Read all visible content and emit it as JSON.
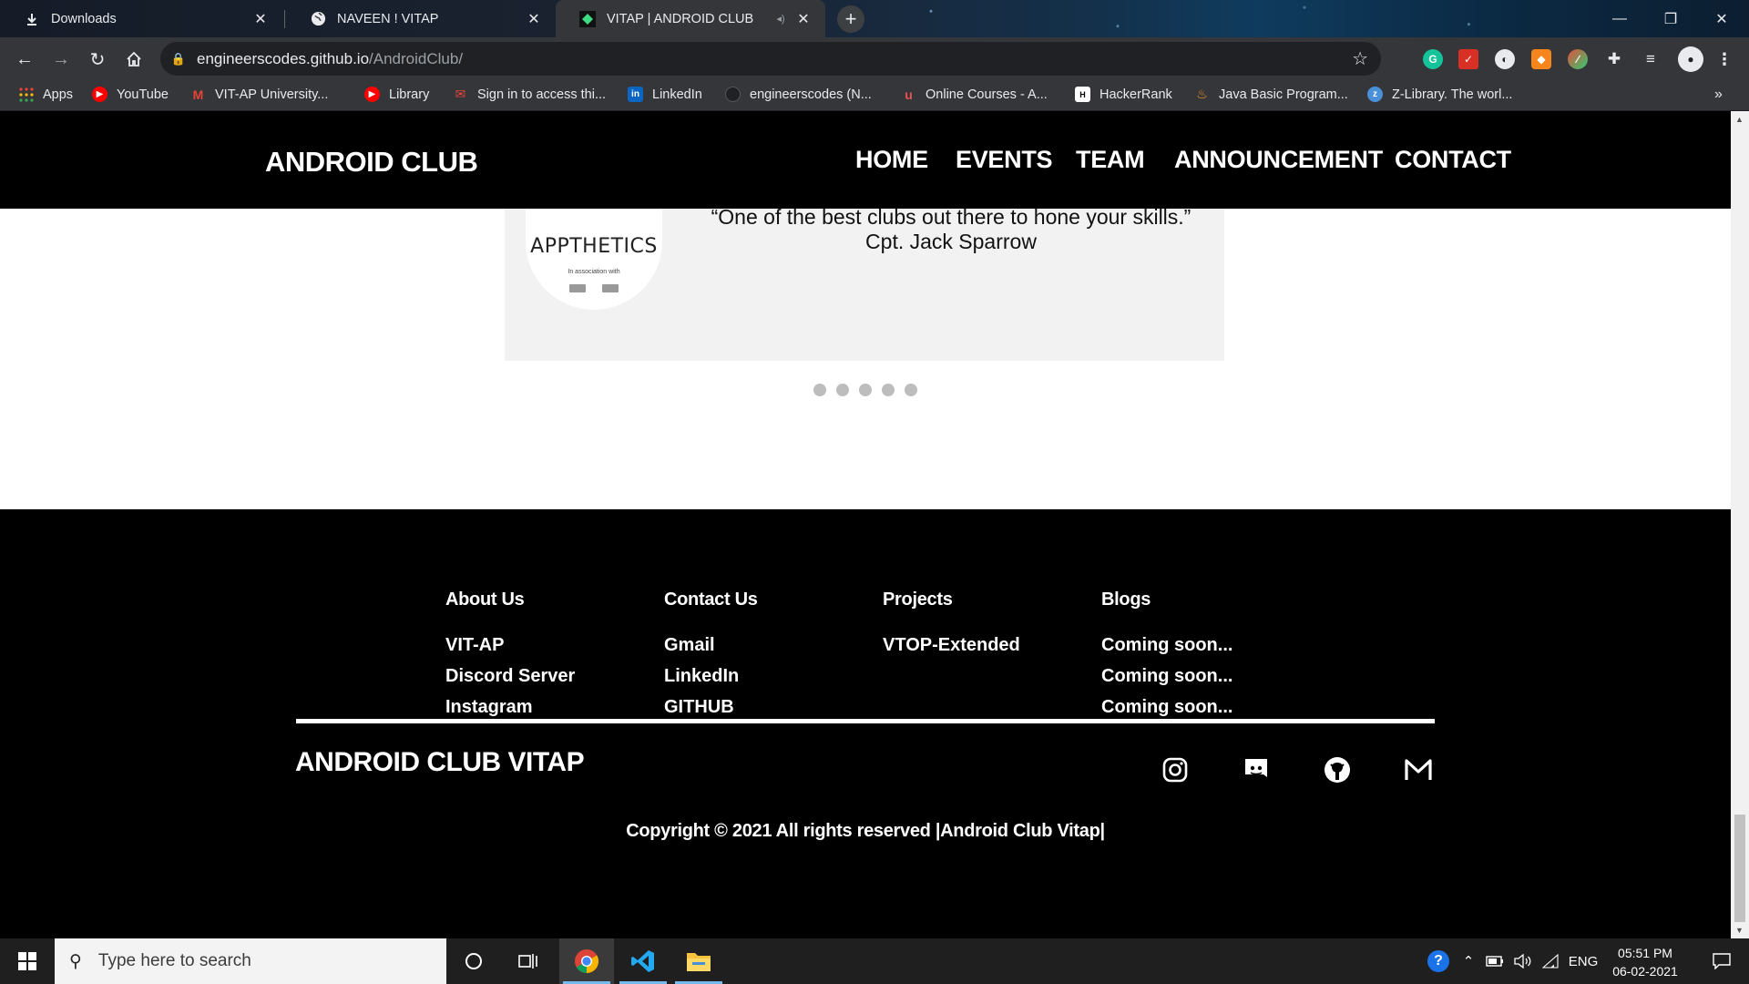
{
  "browser": {
    "tabs": [
      {
        "title": "Downloads",
        "icon": "download-icon"
      },
      {
        "title": "NAVEEN ! VITAP",
        "icon": "globe-icon"
      },
      {
        "title": "VITAP | ANDROID CLUB",
        "icon": "android-club-favicon"
      }
    ],
    "url_host": "engineerscodes.github.io",
    "url_path": "/AndroidClub/",
    "bookmarks": [
      {
        "label": "Apps",
        "icon": "apps-grid-icon"
      },
      {
        "label": "YouTube",
        "icon": "youtube-icon"
      },
      {
        "label": "VIT-AP University...",
        "icon": "gmail-icon"
      },
      {
        "label": "Library",
        "icon": "youtube-icon"
      },
      {
        "label": "Sign in to access thi...",
        "icon": "gmail-icon"
      },
      {
        "label": "LinkedIn",
        "icon": "linkedin-icon"
      },
      {
        "label": "engineerscodes (N...",
        "icon": "github-icon"
      },
      {
        "label": "Online Courses - A...",
        "icon": "udemy-icon"
      },
      {
        "label": "HackerRank",
        "icon": "hackerrank-icon"
      },
      {
        "label": "Java Basic Program...",
        "icon": "java-icon"
      },
      {
        "label": "Z-Library. The worl...",
        "icon": "zlibrary-icon"
      }
    ],
    "bookmarks_overflow": "»"
  },
  "site": {
    "brand": "ANDROID CLUB",
    "nav": [
      "HOME",
      "EVENTS",
      "TEAM",
      "ANNOUNCEMENT",
      "CONTACT"
    ],
    "testimonial": {
      "logo_text": "APPTHETICS",
      "logo_subtext": "In association with",
      "quote": "“One of the best clubs out there to hone your skills.” Cpt. Jack Sparrow"
    },
    "carousel_dot_count": 5,
    "footer": {
      "columns": [
        {
          "heading": "About Us",
          "items": [
            "VIT-AP",
            "Discord Server",
            "Instagram"
          ]
        },
        {
          "heading": "Contact Us",
          "items": [
            "Gmail",
            "LinkedIn",
            "GITHUB"
          ]
        },
        {
          "heading": "Projects",
          "items": [
            "VTOP-Extended"
          ]
        },
        {
          "heading": "Blogs",
          "items": [
            "Coming soon...",
            "Coming soon...",
            "Coming soon..."
          ]
        }
      ],
      "brand": "ANDROID CLUB VITAP",
      "social": [
        "instagram-icon",
        "discord-icon",
        "github-icon",
        "gmail-icon"
      ],
      "copyright": "Copyright © 2021 All rights reserved |Android Club Vitap|"
    }
  },
  "taskbar": {
    "search_placeholder": "Type here to search",
    "language": "ENG",
    "time": "05:51 PM",
    "date": "06-02-2021"
  },
  "colors": {
    "nav_bg": "#000000",
    "footer_bg": "#000000",
    "testimonial_bg": "#f2f2f2",
    "taskbar_bg": "#1f1f1f",
    "chrome_accent": "#35363a"
  }
}
